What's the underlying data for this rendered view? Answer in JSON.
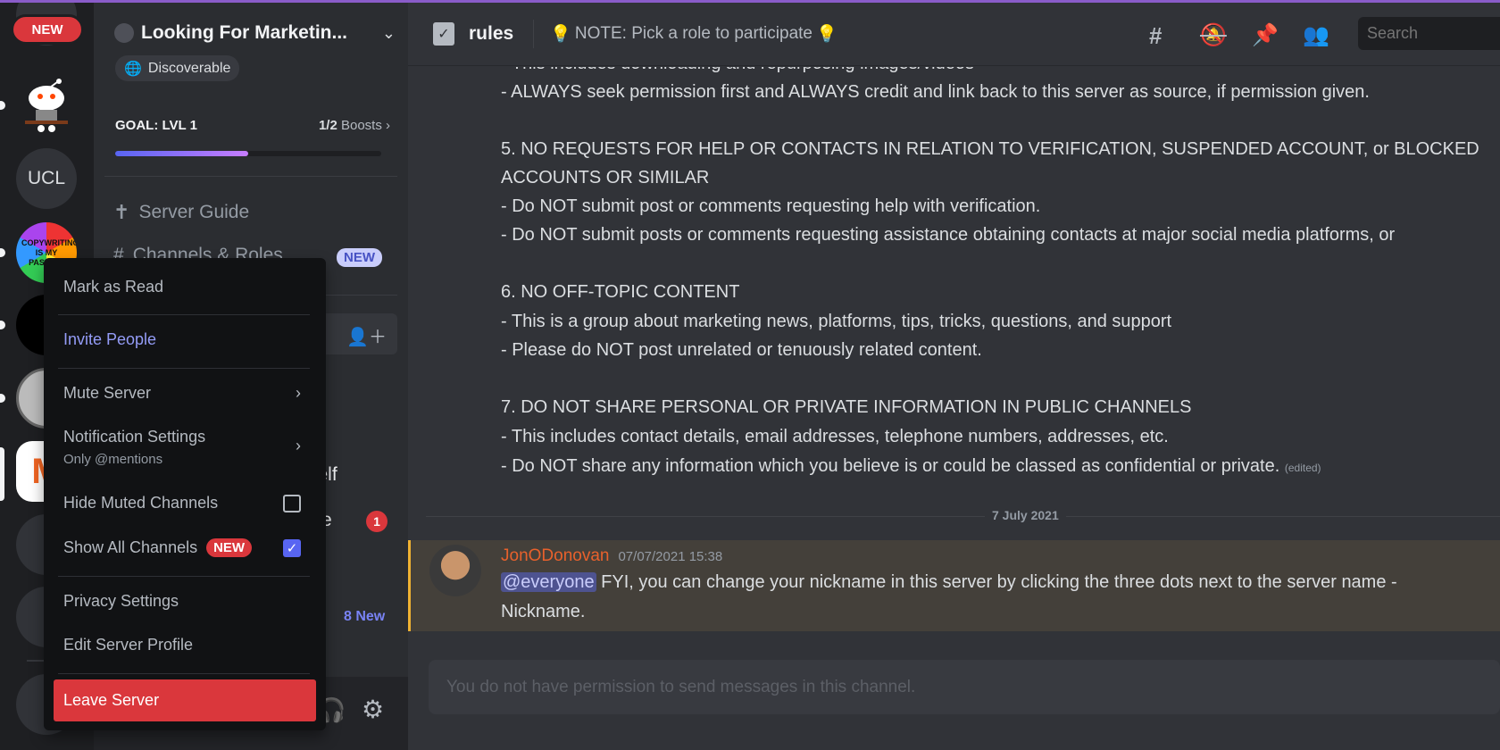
{
  "rail": {
    "new_badge": "NEW",
    "servers": [
      {
        "name": "reddit-server",
        "label": ""
      },
      {
        "name": "ucl-server",
        "label": "UCL"
      },
      {
        "name": "copywriting-server",
        "label": "COPYWRITING IS MY PASSION"
      },
      {
        "name": "fo-server",
        "label": ""
      },
      {
        "name": "reddit-badge-server",
        "label": ""
      },
      {
        "name": "m-server",
        "label": ""
      },
      {
        "name": "green-server",
        "label": ""
      },
      {
        "name": "green-a-server",
        "label": ""
      },
      {
        "name": "bottom-server",
        "label": ""
      }
    ]
  },
  "sidebar": {
    "server_name": "Looking For Marketin...",
    "discoverable": "Discoverable",
    "goal": "GOAL: LVL 1",
    "boosts_count": "1/2",
    "boosts_label": "Boosts",
    "boost_progress": 0.5,
    "server_guide": "Server Guide",
    "channels_roles": "Channels & Roles",
    "new_badge": "NEW",
    "partial_self": "self",
    "partial_e": "e",
    "unread_count": "1",
    "new_count": "8 New"
  },
  "header": {
    "channel": "rules",
    "topic": "NOTE: Pick a role to participate",
    "search_placeholder": "Search"
  },
  "messages": {
    "lines": [
      "- This includes downloading and repurposing images/videos",
      "- ALWAYS seek permission first and ALWAYS credit and link back to this server as source, if permission given.",
      "5. NO REQUESTS FOR HELP OR CONTACTS IN RELATION TO VERIFICATION, SUSPENDED ACCOUNT, or BLOCKED",
      "ACCOUNTS OR SIMILAR",
      "- Do NOT submit post or comments requesting help with verification.",
      "- Do NOT submit posts or comments requesting assistance obtaining contacts at major social media platforms, or",
      "6. NO OFF-TOPIC CONTENT",
      "- This is a group about marketing news, platforms, tips, tricks, questions, and support",
      "- Please do NOT post unrelated or tenuously related content.",
      "7. DO NOT SHARE PERSONAL OR PRIVATE INFORMATION IN PUBLIC CHANNELS",
      "- This includes contact details, email addresses, telephone numbers, addresses, etc.",
      "- Do NOT share any information which you believe is or could be classed as confidential or private."
    ],
    "edited": "(edited)",
    "date_divider": "7 July 2021",
    "post": {
      "author": "JonODonovan",
      "timestamp": "07/07/2021 15:38",
      "mention": "@everyone",
      "text": "FYI, you can change your nickname in this server by clicking the three dots next to the server name -",
      "text2": "Nickname."
    },
    "input_placeholder": "You do not have permission to send messages in this channel."
  },
  "menu": {
    "mark_read": "Mark as Read",
    "invite": "Invite People",
    "mute": "Mute Server",
    "notif": "Notification Settings",
    "notif_sub": "Only @mentions",
    "hide_muted": "Hide Muted Channels",
    "hide_muted_checked": false,
    "show_all": "Show All Channels",
    "show_all_badge": "NEW",
    "show_all_checked": true,
    "privacy": "Privacy Settings",
    "edit_profile": "Edit Server Profile",
    "leave": "Leave Server"
  },
  "colors": {
    "accent": "#5865f2",
    "danger": "#da373c",
    "invite": "#949cf7",
    "author": "#e8612c",
    "highlight": "#44403a"
  }
}
